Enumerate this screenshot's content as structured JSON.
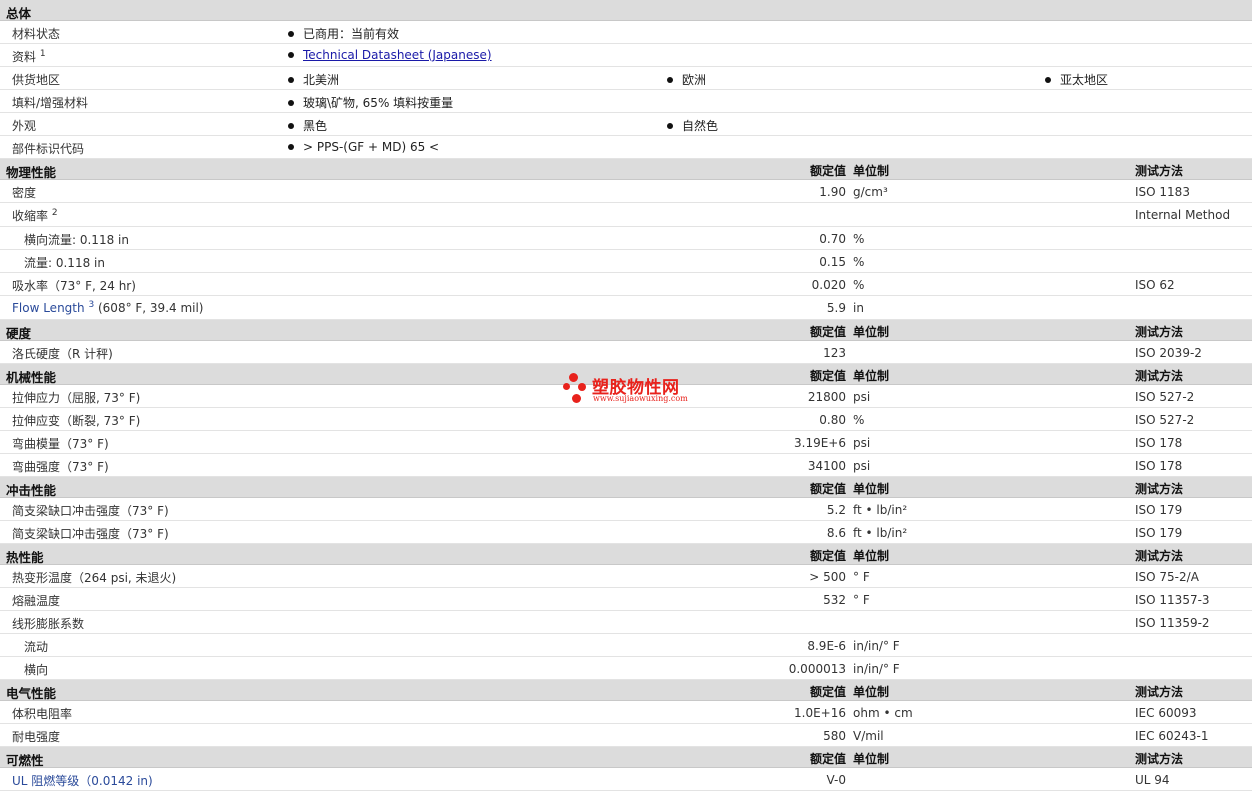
{
  "general": {
    "title": "总体",
    "rows": [
      {
        "label": "材料状态",
        "items": [
          "已商用：当前有效"
        ]
      },
      {
        "label": "资料",
        "sup": "1",
        "link": "Technical Datasheet (Japanese)"
      },
      {
        "label": "供货地区",
        "items": [
          "北美洲",
          "欧洲",
          "亚太地区"
        ]
      },
      {
        "label": "填料/增强材料",
        "items": [
          "玻璃\\矿物, 65% 填料按重量"
        ]
      },
      {
        "label": "外观",
        "items": [
          "黑色",
          "自然色"
        ]
      },
      {
        "label": "部件标识代码",
        "items": [
          "> PPS-(GF + MD) 65 <"
        ]
      }
    ]
  },
  "headers": {
    "value": "额定值",
    "unit": "单位制",
    "method": "测试方法"
  },
  "sections": [
    {
      "title": "物理性能",
      "rows": [
        {
          "label": "密度",
          "value": "1.90",
          "unit": "g/cm³",
          "method": "ISO 1183"
        },
        {
          "label": "收缩率",
          "sup": "2",
          "value": "",
          "unit": "",
          "method": "Internal Method"
        },
        {
          "label": "横向流量: 0.118 in",
          "sub": true,
          "value": "0.70",
          "unit": "%",
          "method": ""
        },
        {
          "label": "流量: 0.118 in",
          "sub": true,
          "value": "0.15",
          "unit": "%",
          "method": ""
        },
        {
          "label": "吸水率（73° F, 24 hr)",
          "value": "0.020",
          "unit": "%",
          "method": "ISO 62"
        },
        {
          "label": "Flow Length",
          "sup": "3",
          "after": " (608° F, 39.4 mil)",
          "link": true,
          "value": "5.9",
          "unit": "in",
          "method": ""
        }
      ]
    },
    {
      "title": "硬度",
      "rows": [
        {
          "label": "洛氏硬度（R 计秤)",
          "value": "123",
          "unit": "",
          "method": "ISO 2039-2"
        }
      ]
    },
    {
      "title": "机械性能",
      "rows": [
        {
          "label": "拉伸应力（屈服, 73° F)",
          "value": "21800",
          "unit": "psi",
          "method": "ISO 527-2"
        },
        {
          "label": "拉伸应变（断裂, 73° F)",
          "value": "0.80",
          "unit": "%",
          "method": "ISO 527-2"
        },
        {
          "label": "弯曲模量（73° F)",
          "value": "3.19E+6",
          "unit": "psi",
          "method": "ISO 178"
        },
        {
          "label": "弯曲强度（73° F)",
          "value": "34100",
          "unit": "psi",
          "method": "ISO 178"
        }
      ]
    },
    {
      "title": "冲击性能",
      "rows": [
        {
          "label": "简支梁缺口冲击强度（73° F)",
          "value": "5.2",
          "unit": "ft • lb/in²",
          "method": "ISO 179"
        },
        {
          "label": "简支梁缺口冲击强度（73° F)",
          "value": "8.6",
          "unit": "ft • lb/in²",
          "method": "ISO 179"
        }
      ]
    },
    {
      "title": "热性能",
      "rows": [
        {
          "label": "热变形温度（264 psi, 未退火)",
          "value": "> 500",
          "unit": "° F",
          "method": "ISO 75-2/A"
        },
        {
          "label": "熔融温度",
          "value": "532",
          "unit": "° F",
          "method": "ISO 11357-3"
        },
        {
          "label": "线形膨胀系数",
          "value": "",
          "unit": "",
          "method": "ISO 11359-2"
        },
        {
          "label": "流动",
          "sub": true,
          "value": "8.9E-6",
          "unit": "in/in/° F",
          "method": ""
        },
        {
          "label": "横向",
          "sub": true,
          "value": "0.000013",
          "unit": "in/in/° F",
          "method": ""
        }
      ]
    },
    {
      "title": "电气性能",
      "rows": [
        {
          "label": "体积电阻率",
          "value": "1.0E+16",
          "unit": "ohm • cm",
          "method": "IEC 60093"
        },
        {
          "label": "耐电强度",
          "value": "580",
          "unit": "V/mil",
          "method": "IEC 60243-1"
        }
      ]
    },
    {
      "title": "可燃性",
      "rows": [
        {
          "label": "UL 阻燃等级（0.0142 in)",
          "link": true,
          "value": "V-0",
          "unit": "",
          "method": "UL 94"
        }
      ]
    }
  ],
  "watermark": {
    "name": "塑胶物性网",
    "url": "www.sujiaowuxing.com",
    "color": "#e8221c"
  }
}
